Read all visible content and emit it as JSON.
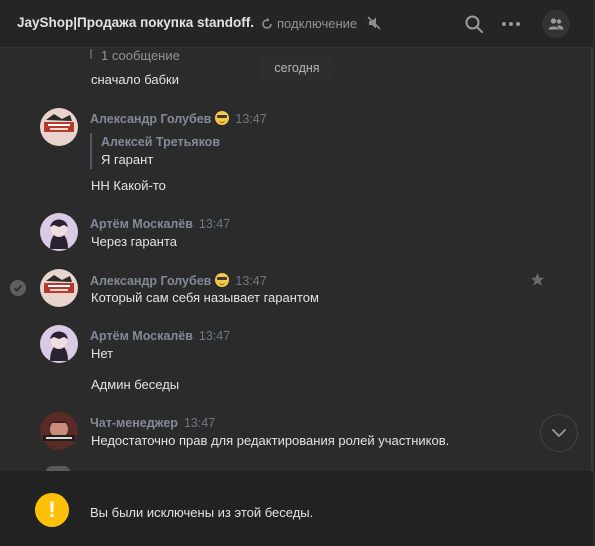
{
  "header": {
    "title": "JayShop|Продажа покупка standoff.",
    "connection_status": "подключение",
    "icons": [
      "mute-icon",
      "search-icon",
      "more-icon",
      "members-icon"
    ]
  },
  "feed": {
    "partial_forward_label": "1 сообщение",
    "partial_message_text": "сначало бабки",
    "date_divider": "сегодня",
    "messages": [
      {
        "author": "Александр Голубев",
        "time": "13:47",
        "forwarded_author": "Алексей Третьяков",
        "forwarded_text": "Я гарант",
        "text": "НН Какой-то"
      },
      {
        "author": "Артём Москалёв",
        "time": "13:47",
        "text": "Через гаранта"
      },
      {
        "author": "Александр Голубев",
        "time": "13:47",
        "text": "Который сам себя называет гарантом"
      },
      {
        "author": "Артём Москалёв",
        "time": "13:47",
        "text": "Нет",
        "text2": "Админ беседы"
      },
      {
        "author": "Чат-менеджер",
        "time": "13:47",
        "text": "Недостаточно прав для редактирования ролей участников."
      }
    ]
  },
  "banner": {
    "icon_symbol": "!",
    "text": "Вы были исключены из этой беседы.",
    "accent": "#ffc107"
  }
}
